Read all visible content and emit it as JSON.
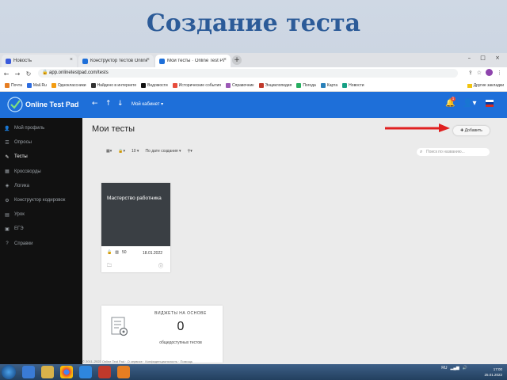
{
  "slide": {
    "title": "Создание теста"
  },
  "browser": {
    "tabs": [
      {
        "label": "Новость",
        "favicon_color": "#3b5bdb",
        "active": false
      },
      {
        "label": "Конструктор тестов Online Test Pad",
        "favicon_color": "#1e6fd9",
        "active": false
      },
      {
        "label": "Мои тесты · Online Test Pad",
        "favicon_color": "#1e6fd9",
        "active": true
      }
    ],
    "new_tab": "+",
    "window_controls": "–  □  ×",
    "url": "app.onlinetestpad.com/tests",
    "bookmarks": [
      {
        "label": "Почта",
        "color": "#e67e22"
      },
      {
        "label": "Mail.Ru",
        "color": "#2d6cdf"
      },
      {
        "label": "Одноклассники",
        "color": "#f39c12"
      },
      {
        "label": "Найдено в интернете",
        "color": "#333333"
      },
      {
        "label": "Ведомости",
        "color": "#111111"
      },
      {
        "label": "Исторические события",
        "color": "#e74c3c"
      },
      {
        "label": "Справочник",
        "color": "#9b59b6"
      },
      {
        "label": "Энциклопедия",
        "color": "#c0392b"
      },
      {
        "label": "Погода",
        "color": "#27ae60"
      },
      {
        "label": "Карта",
        "color": "#2980b9"
      },
      {
        "label": "Новости",
        "color": "#16a085"
      }
    ],
    "other_bookmarks": "Другие закладки"
  },
  "app": {
    "logo_text": "Online Test Pad",
    "header_icons": [
      "←",
      "↑",
      "↓"
    ],
    "my_account": "Мой кабинет ▾",
    "notification_count": "1",
    "sidebar": [
      {
        "label": "Мой профиль",
        "icon": "👤",
        "active": false
      },
      {
        "label": "Опросы",
        "icon": "☰",
        "active": false
      },
      {
        "label": "Тесты",
        "icon": "✎",
        "active": true
      },
      {
        "label": "Кроссворды",
        "icon": "▦",
        "active": false
      },
      {
        "label": "Логика",
        "icon": "◈",
        "active": false
      },
      {
        "label": "Конструктор кодировок",
        "icon": "⚙",
        "active": false
      },
      {
        "label": "Урок",
        "icon": "▤",
        "active": false
      },
      {
        "label": "ЕГЭ",
        "icon": "▣",
        "active": false
      },
      {
        "label": "Справки",
        "icon": "?",
        "active": false
      }
    ],
    "page_title": "Мои тесты",
    "add_button": "✚ Добавить",
    "toolbar": {
      "view": "▦▾",
      "lock": "🔒▾",
      "count": "10 ▾",
      "sort": "По дате создания ▾",
      "filter": "⚲▾"
    },
    "search_placeholder": "Поиск по названию...",
    "test_card": {
      "title": "Мастерство работника",
      "status_icon": "🔓",
      "results": "50",
      "date": "18.01.2022"
    },
    "widget": {
      "title": "ВИДЖЕТЫ НА ОСНОВЕ",
      "value": "0",
      "subtitle": "общедоступных тестов"
    },
    "statusbar": "© 2011–2022 Online Test Pad · О сервисе · Конфиденциальность · Помощь"
  },
  "taskbar": {
    "lang": "RU",
    "time": "17:00",
    "date": "25.01.2022"
  },
  "colors": {
    "header_blue": "#1e6fd9",
    "sidebar_bg": "#111111",
    "title_blue": "#2c5b98",
    "arrow_red": "#e02020"
  }
}
